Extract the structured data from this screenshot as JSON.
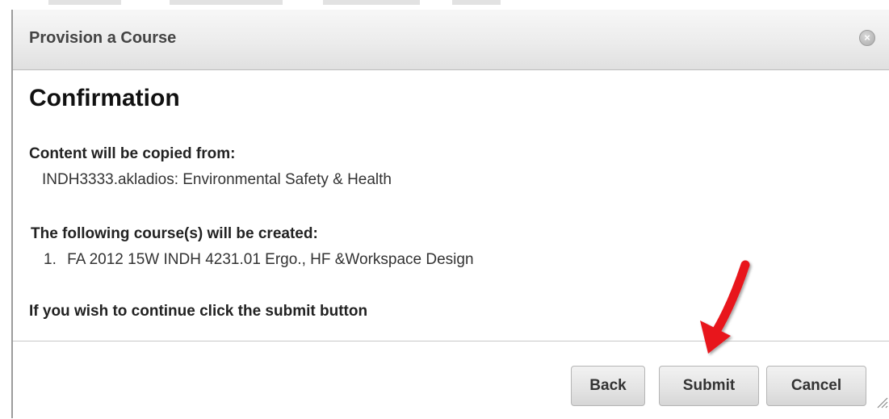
{
  "dialog": {
    "title": "Provision a Course",
    "close_icon": "close-icon",
    "close_glyph": "×"
  },
  "content": {
    "heading": "Confirmation",
    "copied_from_label": "Content will be copied from:",
    "copied_from_value": "INDH3333.akladios: Environmental Safety & Health",
    "courses_label": "The following course(s) will be created:",
    "courses": [
      {
        "number": "1.",
        "name": "FA 2012 15W INDH 4231.01 Ergo., HF &Workspace Design"
      }
    ],
    "instruction": "If you wish to continue click the submit button"
  },
  "footer": {
    "back_label": "Back",
    "submit_label": "Submit",
    "cancel_label": "Cancel"
  },
  "annotation": {
    "arrow_icon": "red-arrow-icon",
    "arrow_color": "#e8141b"
  },
  "colors": {
    "title_text": "#444444",
    "button_text": "#333333"
  }
}
